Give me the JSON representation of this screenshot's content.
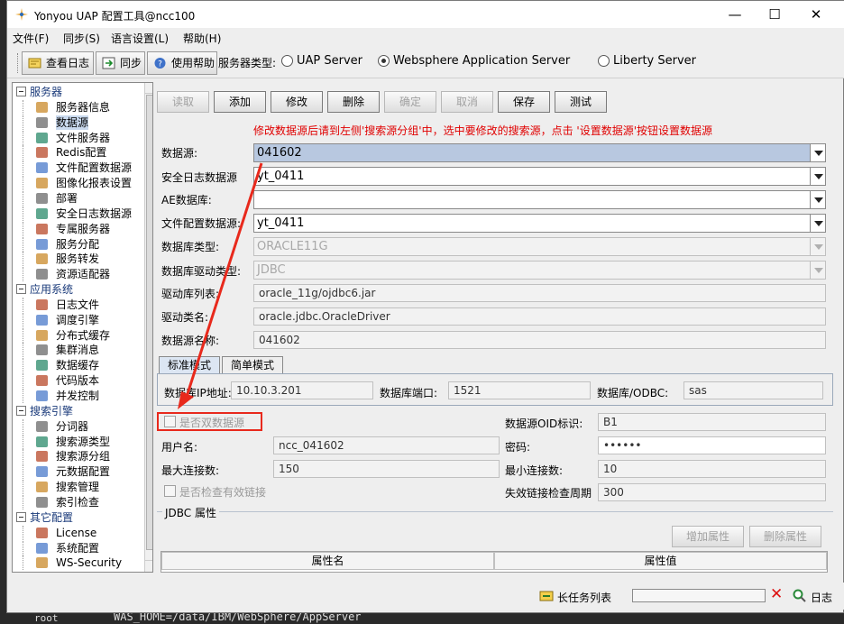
{
  "window": {
    "title": "Yonyou UAP 配置工具@ncc100",
    "minimize_symbol": "—",
    "maximize_symbol": "☐",
    "close_symbol": "✕"
  },
  "menu": [
    "文件(F)",
    "同步(S)",
    "语言设置(L)",
    "帮助(H)"
  ],
  "toolbar": {
    "view_log": "查看日志",
    "sync": "同步",
    "help": "使用帮助",
    "server_type_label": "服务器类型:",
    "server_options": [
      "UAP Server",
      "Websphere Application Server",
      "Liberty Server"
    ],
    "selected_server": "Websphere Application Server"
  },
  "tree": {
    "items": [
      {
        "label": "服务器",
        "level": 0,
        "group": true
      },
      {
        "label": "服务器信息",
        "level": 1
      },
      {
        "label": "数据源",
        "level": 1,
        "selected": true
      },
      {
        "label": "文件服务器",
        "level": 1
      },
      {
        "label": "Redis配置",
        "level": 1
      },
      {
        "label": "文件配置数据源",
        "level": 1
      },
      {
        "label": "图像化报表设置",
        "level": 1
      },
      {
        "label": "部署",
        "level": 1
      },
      {
        "label": "安全日志数据源",
        "level": 1
      },
      {
        "label": "专属服务器",
        "level": 1
      },
      {
        "label": "服务分配",
        "level": 1
      },
      {
        "label": "服务转发",
        "level": 1
      },
      {
        "label": "资源适配器",
        "level": 1
      },
      {
        "label": "应用系统",
        "level": 0,
        "group": true
      },
      {
        "label": "日志文件",
        "level": 1
      },
      {
        "label": "调度引擎",
        "level": 1
      },
      {
        "label": "分布式缓存",
        "level": 1
      },
      {
        "label": "集群消息",
        "level": 1
      },
      {
        "label": "数据缓存",
        "level": 1
      },
      {
        "label": "代码版本",
        "level": 1
      },
      {
        "label": "并发控制",
        "level": 1
      },
      {
        "label": "搜索引擎",
        "level": 0,
        "group": true
      },
      {
        "label": "分词器",
        "level": 1
      },
      {
        "label": "搜索源类型",
        "level": 1
      },
      {
        "label": "搜索源分组",
        "level": 1
      },
      {
        "label": "元数据配置",
        "level": 1
      },
      {
        "label": "搜索管理",
        "level": 1
      },
      {
        "label": "索引检查",
        "level": 1
      },
      {
        "label": "其它配置",
        "level": 0,
        "group": true
      },
      {
        "label": "License",
        "level": 1
      },
      {
        "label": "系统配置",
        "level": 1
      },
      {
        "label": "WS-Security",
        "level": 1
      }
    ]
  },
  "actions": {
    "read": "读取",
    "add": "添加",
    "modify": "修改",
    "delete": "删除",
    "confirm": "确定",
    "cancel": "取消",
    "save": "保存",
    "test": "测试"
  },
  "hint": "修改数据源后请到左侧'搜索源分组'中，选中要修改的搜索源，点击 '设置数据源'按钮设置数据源",
  "form": {
    "datasource_label": "数据源:",
    "datasource_value": "041602",
    "security_log_label": "安全日志数据源",
    "security_log_value": "yt_0411",
    "ae_label": "AE数据库:",
    "ae_value": "",
    "file_config_label": "文件配置数据源:",
    "file_config_value": "yt_0411",
    "db_type_label": "数据库类型:",
    "db_type_value": "ORACLE11G",
    "db_driver_type_label": "数据库驱动类型:",
    "db_driver_type_value": "JDBC",
    "driver_list_label": "驱动库列表:",
    "driver_list_value": "oracle_11g/ojdbc6.jar",
    "driver_class_label": "驱动类名:",
    "driver_class_value": "oracle.jdbc.OracleDriver",
    "ds_name_label": "数据源名称:",
    "ds_name_value": "041602"
  },
  "tabs": [
    "标准模式",
    "简单模式"
  ],
  "standard": {
    "db_host_label": "数据库IP地址:",
    "db_host_value": "10.10.3.201",
    "db_port_label": "数据库端口:",
    "db_port_value": "1521",
    "db_odbc_label": "数据库/ODBC:",
    "db_odbc_value": "sas",
    "dual_ds_label": "是否双数据源",
    "oid_label": "数据源OID标识:",
    "oid_value": "B1",
    "username_label": "用户名:",
    "username_value": "ncc_041602",
    "password_label": "密码:",
    "password_value": "••••••",
    "max_conn_label": "最大连接数:",
    "max_conn_value": "150",
    "min_conn_label": "最小连接数:",
    "min_conn_value": "10",
    "check_valid_label": "是否检查有效链接",
    "invalid_period_label": "失效链接检查周期",
    "invalid_period_value": "300"
  },
  "jdbc": {
    "title": "JDBC 属性",
    "add_prop": "增加属性",
    "del_prop": "删除属性",
    "col_name": "属性名",
    "col_value": "属性值"
  },
  "status": {
    "long_task": "长任务列表",
    "log": "日志"
  },
  "background": {
    "terminal_text": "WAS_HOME=/data/IBM/WebSphere/AppServer",
    "root_text": "root"
  },
  "colors": {
    "hint_red": "#e00000",
    "annotation_red": "#e8291c",
    "selection_blue": "#c9d9ee"
  }
}
